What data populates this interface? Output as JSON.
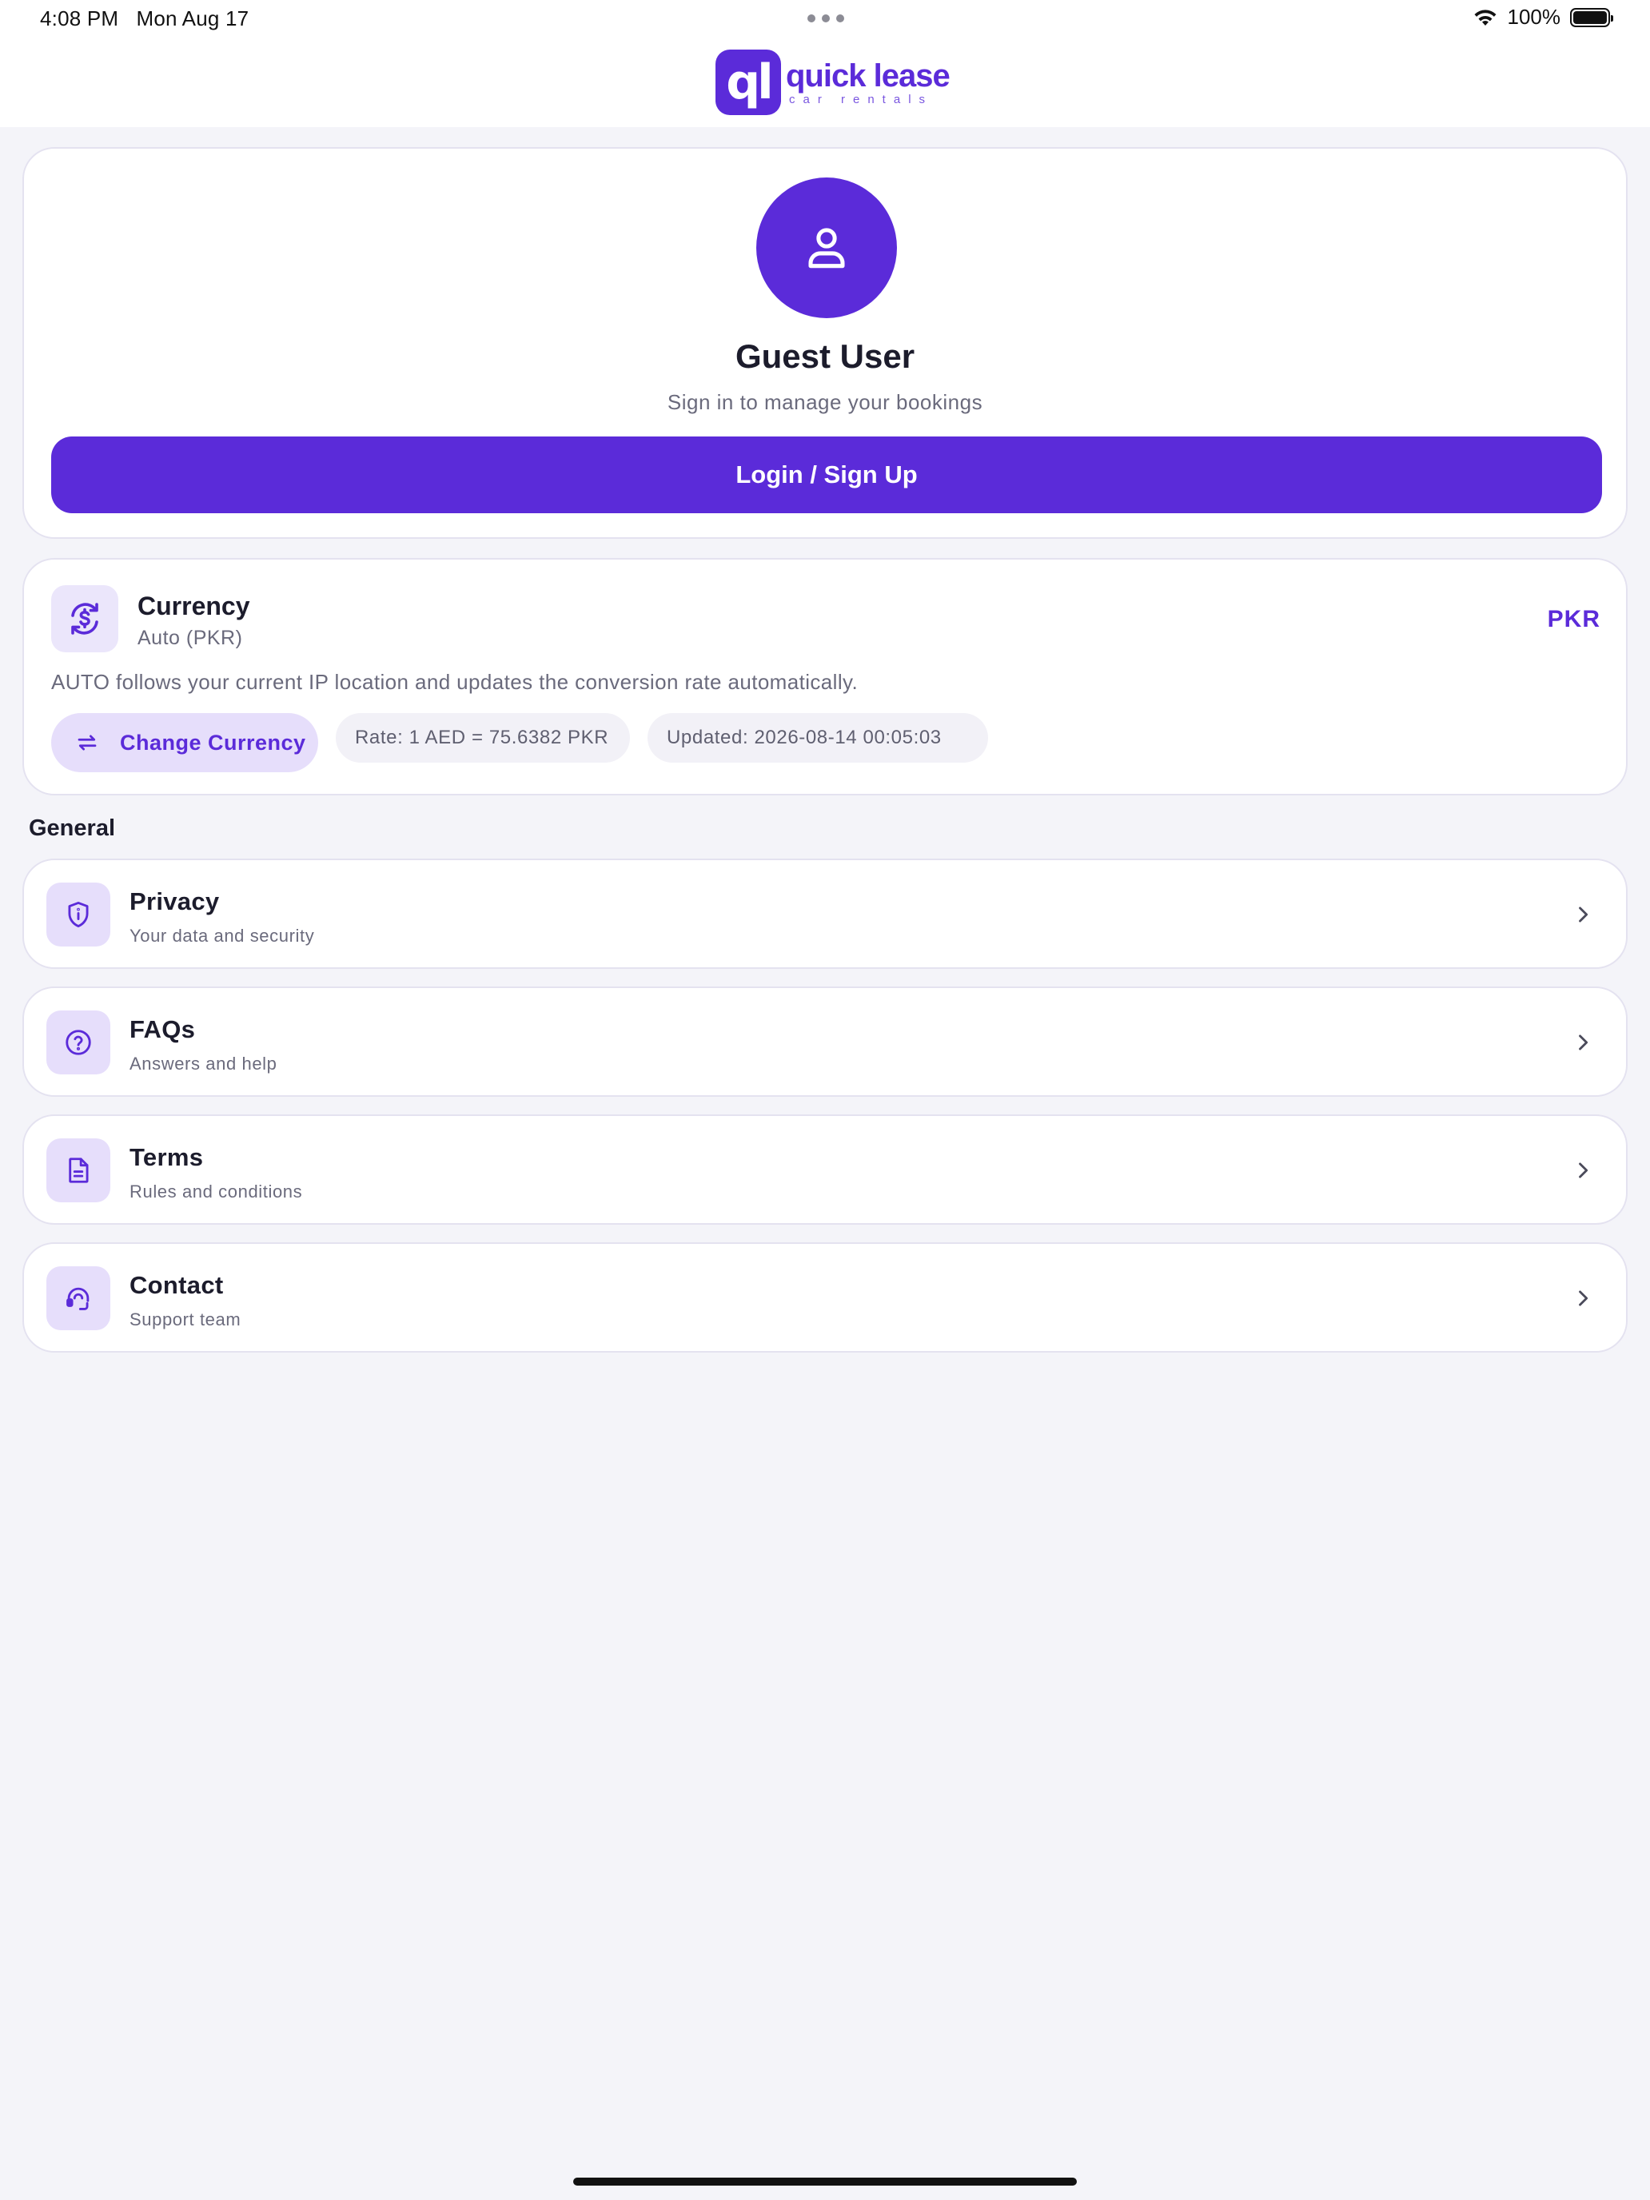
{
  "status_bar": {
    "time": "4:08 PM",
    "date": "Mon Aug 17",
    "battery": "100%"
  },
  "logo": {
    "mark": "ql",
    "title": "quick lease",
    "subtitle": "car rentals"
  },
  "profile": {
    "name": "Guest User",
    "subtitle": "Sign in to manage your bookings",
    "login_label": "Login / Sign Up"
  },
  "currency": {
    "title": "Currency",
    "mode": "Auto (PKR)",
    "code": "PKR",
    "description": "AUTO follows your current IP location and updates the conversion rate automatically.",
    "change_label": "Change Currency",
    "rate": "Rate: 1 AED = 75.6382 PKR",
    "updated": "Updated: 2026-08-14 00:05:03"
  },
  "general": {
    "label": "General",
    "items": [
      {
        "title": "Privacy",
        "subtitle": "Your data and security",
        "icon": "shield-icon"
      },
      {
        "title": "FAQs",
        "subtitle": "Answers and help",
        "icon": "question-icon"
      },
      {
        "title": "Terms",
        "subtitle": "Rules and conditions",
        "icon": "document-icon"
      },
      {
        "title": "Contact",
        "subtitle": "Support team",
        "icon": "headset-icon"
      }
    ]
  },
  "colors": {
    "accent": "#5b2bd9",
    "accent_soft": "#e6defb",
    "background": "#f4f4f9"
  }
}
